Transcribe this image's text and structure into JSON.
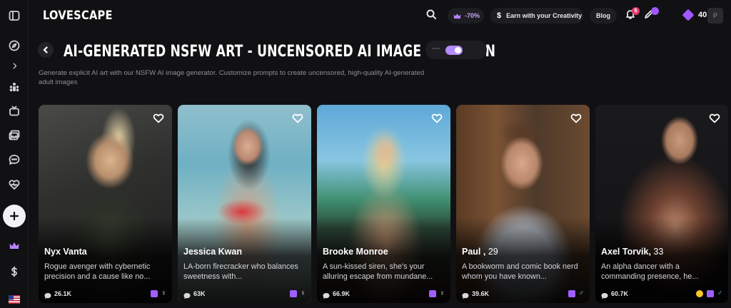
{
  "brand": {
    "logo": "LOVESCAPE"
  },
  "topbar": {
    "discount": "-70%",
    "earn_label": "Earn with your Creativity",
    "blog_label": "Blog",
    "notification_count": "5",
    "credits": "40",
    "avatar_initial": "P"
  },
  "page": {
    "title": "AI-GENERATED NSFW ART - UNCENSORED AI IMAGE CREATION",
    "description": "Generate explicit AI art with our NSFW AI image generator. Customize prompts to create uncensored, high-quality AI-generated adult images",
    "toggle_label": "‘’‘’‘’",
    "toggle_on": true
  },
  "cards": [
    {
      "name": "Nyx Vanta",
      "age": "",
      "description": "Rogue avenger with cybernetic precision and a cause like no...",
      "chats": "26.1K",
      "gender": "♀",
      "gender_type": "female",
      "icons": [
        "purple-badge"
      ]
    },
    {
      "name": "Jessica Kwan",
      "age": "",
      "description": "LA-born firecracker who balances sweetness with...",
      "chats": "63K",
      "gender": "♀",
      "gender_type": "female",
      "icons": [
        "purple-badge"
      ]
    },
    {
      "name": "Brooke Monroe",
      "age": "",
      "description": "A sun-kissed siren, she's your alluring escape from mundane...",
      "chats": "66.9K",
      "gender": "♀",
      "gender_type": "female",
      "icons": [
        "purple-badge"
      ]
    },
    {
      "name": "Paul",
      "age": "29",
      "description": "A bookworm and comic book nerd whom you have known...",
      "chats": "39.6K",
      "gender": "♂",
      "gender_type": "male",
      "icons": [
        "purple-badge"
      ]
    },
    {
      "name": "Axel Torvik",
      "age": "33",
      "description": "An alpha dancer with a commanding presence, he...",
      "chats": "60.7K",
      "gender": "♂",
      "gender_type": "male",
      "icons": [
        "emoji-badge",
        "purple-badge"
      ]
    }
  ],
  "sidebar": {
    "items": [
      {
        "icon": "layout-icon"
      },
      {
        "icon": "compass-icon"
      },
      {
        "icon": "chevron-right-icon"
      },
      {
        "icon": "community-icon"
      },
      {
        "icon": "tv-icon"
      },
      {
        "icon": "gallery-icon"
      },
      {
        "icon": "chat-icon"
      },
      {
        "icon": "heart-pulse-icon"
      },
      {
        "icon": "plus-icon"
      },
      {
        "icon": "crown-icon"
      },
      {
        "icon": "dollar-icon"
      },
      {
        "icon": "us-flag-icon"
      }
    ]
  },
  "colors": {
    "background": "#111113",
    "accent": "#a256ff",
    "accent_light": "#b38cff",
    "notification": "#e83a6f"
  }
}
